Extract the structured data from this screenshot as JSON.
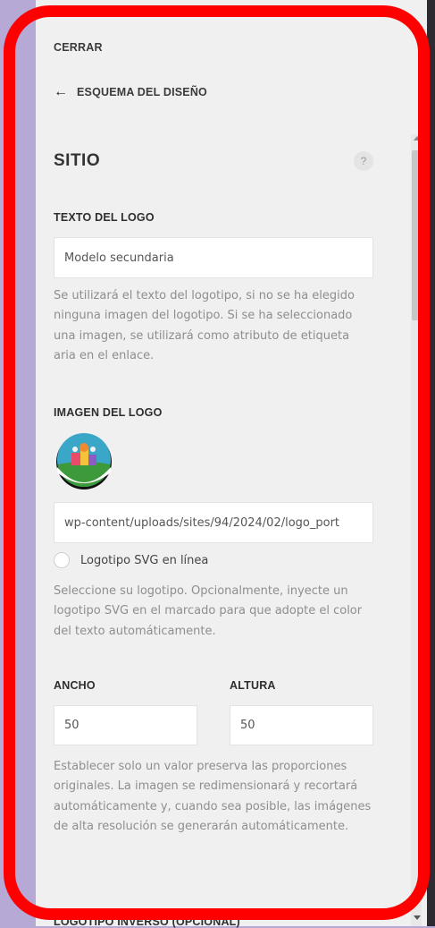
{
  "header": {
    "close_label": "CERRAR",
    "back_label": "ESQUEMA DEL DISEÑO",
    "back_icon": "arrow-left-icon"
  },
  "section": {
    "title": "SITIO",
    "help_icon": "question-mark-icon",
    "help_text": "?"
  },
  "logo_text": {
    "label": "TEXTO DEL LOGO",
    "value": "Modelo secundaria",
    "help": "Se utilizará el texto del logotipo, si no se ha elegido ninguna imagen del logotipo. Si se ha seleccionado una imagen, se utilizará como atributo de etiqueta aria en el enlace."
  },
  "logo_image": {
    "label": "IMAGEN DEL LOGO",
    "url_value": "wp-content/uploads/sites/94/2024/02/logo_port",
    "svg_inline_label": "Logotipo SVG en línea",
    "svg_inline_checked": false,
    "help": "Seleccione su logotipo. Opcionalmente, inyecte un logotipo SVG en el marcado para que adopte el color del texto automáticamente."
  },
  "dimensions": {
    "width_label": "ANCHO",
    "width_value": "50",
    "height_label": "ALTURA",
    "height_value": "50",
    "help": "Establecer solo un valor preserva las proporciones originales. La imagen se redimensionará y recortará automáticamente y, cuando sea posible, las imágenes de alta resolución se generarán automáticamente."
  },
  "inverse_logo": {
    "label": "LOGOTIPO INVERSO (OPCIONAL)"
  },
  "colors": {
    "highlight_frame": "#ff0000",
    "panel_bg": "#f0f0f0",
    "backdrop": "#b7a9d6"
  }
}
